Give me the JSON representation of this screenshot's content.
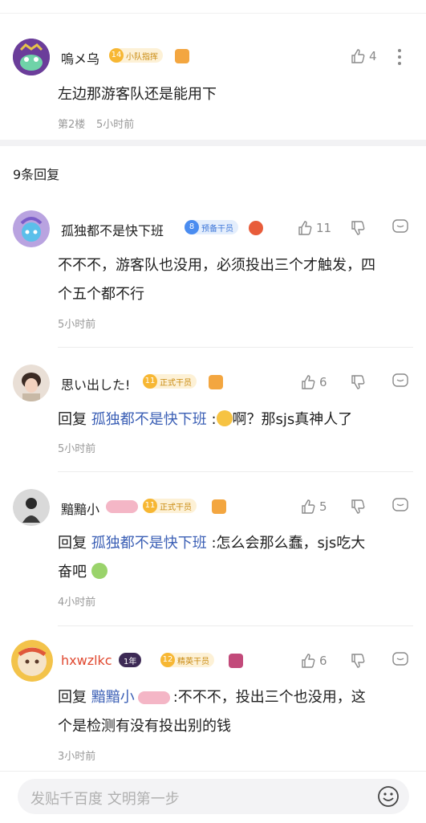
{
  "main_comment": {
    "username": "嗚メ乌",
    "level": "14",
    "badge_title": "小队指挥",
    "likes": "4",
    "content": "左边那游客队还是能用下",
    "floor": "第2楼",
    "time": "5小时前"
  },
  "replies_header": "9条回复",
  "replies": [
    {
      "username": "孤独都不是快下班",
      "level": "8",
      "badge_title": "预备干员",
      "likes": "11",
      "content_line1": "不不不，游客队也没用，必须投出三个才触发，四",
      "content_line2": "个五个都不行",
      "time": "5小时前"
    },
    {
      "username": "思い出した!",
      "level": "11",
      "badge_title": "正式干员",
      "likes": "6",
      "reply_prefix": "回复",
      "reply_to": "孤独都不是快下班",
      "content": ":",
      "content_after": "啊？那sjs真神人了",
      "time": "5小时前"
    },
    {
      "username": "黯黯小",
      "level": "11",
      "badge_title": "正式干员",
      "likes": "5",
      "reply_prefix": "回复",
      "reply_to": "孤独都不是快下班",
      "content": ":怎么会那么蠢，sjs吃大",
      "content_line2": "奋吧",
      "time": "4小时前"
    },
    {
      "username": "hxwzlkc",
      "year_badge": "1年",
      "level": "12",
      "badge_title": "精英干员",
      "likes": "6",
      "reply_prefix": "回复",
      "reply_to": "黯黯小",
      "content": ":不不不，投出三个也没用，这",
      "content_line2": "个是检测有没有投出别的钱",
      "time": "3小时前"
    }
  ],
  "composer": {
    "placeholder": "发贴千百度 文明第一步"
  },
  "colors": {
    "link": "#3b5fb5",
    "vip_name": "#e0472e",
    "gold_badge": "#f7b733",
    "blue_badge": "#4a8cf0"
  }
}
